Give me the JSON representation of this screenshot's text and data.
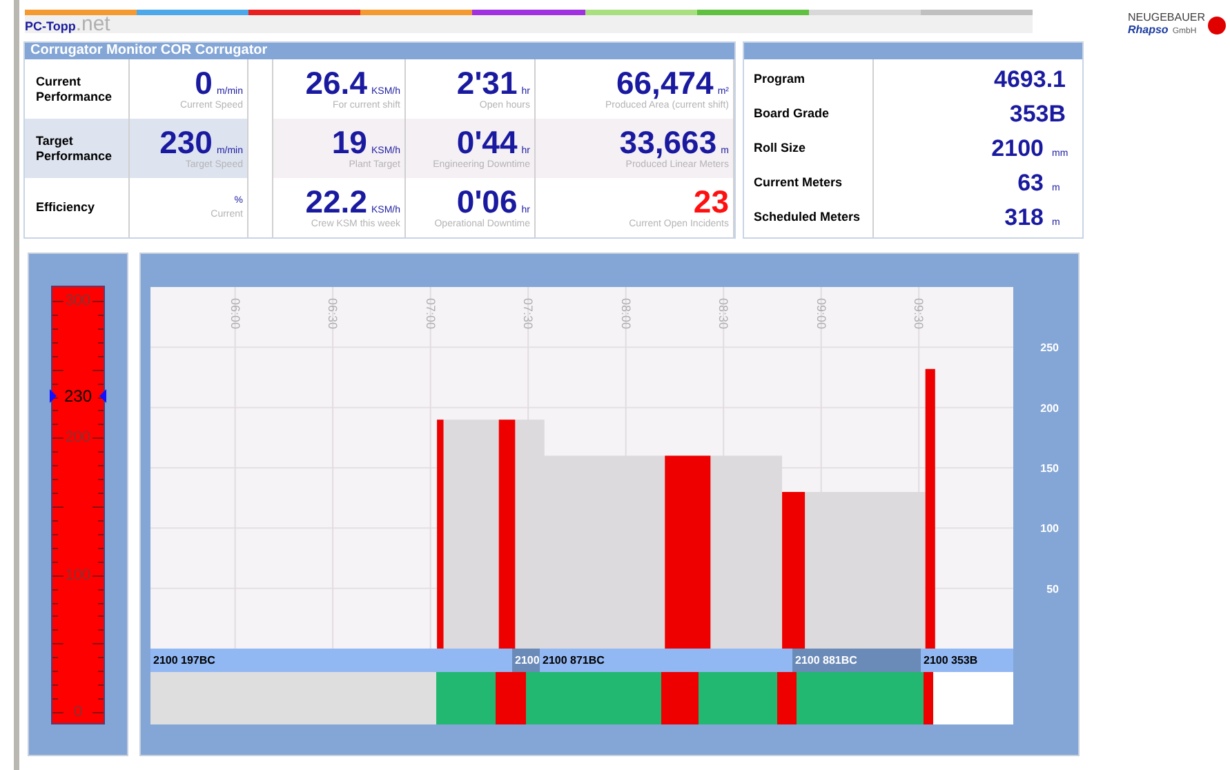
{
  "header": {
    "logo": "PC-Topp",
    "logo_suffix": ".net",
    "brand": {
      "line1": "NEUGEBAUER",
      "line2": "Rhapso",
      "line3": "GmbH"
    }
  },
  "metrics": {
    "title": "Corrugator Monitor COR Corrugator",
    "rows": [
      {
        "label": "Current Performance",
        "highlighted": false,
        "speed": {
          "value": "0",
          "unit": "m/min",
          "caption": "Current Speed"
        },
        "cells": [
          {
            "value": "26.4",
            "unit": "KSM/h",
            "caption": "For current shift",
            "alert": false
          },
          {
            "value": "2'31",
            "unit": "hr",
            "caption": "Open hours",
            "alert": false
          },
          {
            "value": "66,474",
            "unit": "m²",
            "caption": "Produced Area (current shift)",
            "alert": false
          }
        ]
      },
      {
        "label": "Target Performance",
        "highlighted": true,
        "speed": {
          "value": "230",
          "unit": "m/min",
          "caption": "Target Speed"
        },
        "cells": [
          {
            "value": "19",
            "unit": "KSM/h",
            "caption": "Plant Target",
            "alert": false
          },
          {
            "value": "0'44",
            "unit": "hr",
            "caption": "Engineering Downtime",
            "alert": false
          },
          {
            "value": "33,663",
            "unit": "m",
            "caption": "Produced Linear Meters",
            "alert": false
          }
        ]
      },
      {
        "label": "Efficiency",
        "highlighted": false,
        "speed": {
          "unit": "%",
          "caption": "Current"
        },
        "cells": [
          {
            "value": "22.2",
            "unit": "KSM/h",
            "caption": "Crew KSM this week",
            "alert": false
          },
          {
            "value": "0'06",
            "unit": "hr",
            "caption": "Operational Downtime",
            "alert": false
          },
          {
            "value": "23",
            "caption": "Current Open Incidents",
            "alert": true
          }
        ]
      }
    ]
  },
  "order_info": [
    {
      "label": "Program",
      "value": "4693.1"
    },
    {
      "label": "Board Grade",
      "value": "353B"
    },
    {
      "label": "Roll Size",
      "value": "2100",
      "unit": "mm"
    },
    {
      "label": "Current Meters",
      "value": "63",
      "unit": "m"
    },
    {
      "label": "Scheduled Meters",
      "value": "318",
      "unit": "m"
    }
  ],
  "gauge": {
    "labels": [
      "300",
      "200",
      "100",
      "0"
    ],
    "marker": {
      "text": "230",
      "level": 0.767
    }
  },
  "speed_chart": {
    "chart_data": {
      "type": "area",
      "x": [
        422,
        422,
        424,
        424,
        441,
        441,
        446,
        446,
        455,
        455,
        492,
        492,
        506,
        506,
        528,
        528,
        535,
        535,
        572,
        572,
        575,
        575
      ],
      "series": [
        {
          "color": "#dcdadc",
          "values": [
            0,
            190,
            190,
            190,
            190,
            190,
            190,
            190,
            190,
            160,
            160,
            160,
            160,
            160,
            160,
            130,
            130,
            130,
            130,
            0,
            0,
            0
          ]
        },
        {
          "color": "#ee0000",
          "values": [
            0,
            190,
            190,
            0,
            0,
            190,
            190,
            0,
            0,
            0,
            0,
            160,
            160,
            0,
            0,
            130,
            130,
            0,
            0,
            232,
            232,
            0
          ]
        }
      ],
      "xlim": [
        334,
        599
      ],
      "ylim": [
        0,
        300
      ],
      "stacked": false,
      "grid": true,
      "xticks": [
        {
          "value": 360,
          "label": "06:00"
        },
        {
          "value": 390,
          "label": "06:30"
        },
        {
          "value": 420,
          "label": "07:00"
        },
        {
          "value": 450,
          "label": "07:30"
        },
        {
          "value": 480,
          "label": "08:00"
        },
        {
          "value": 510,
          "label": "08:30"
        },
        {
          "value": 540,
          "label": "09:00"
        },
        {
          "value": 570,
          "label": "09:30"
        }
      ],
      "yticks": [
        50,
        100,
        150,
        200,
        250
      ]
    },
    "orders": [
      {
        "label": "2100 197BC",
        "selected": false
      },
      {
        "label": "2100",
        "selected": true
      },
      {
        "label": "2100 871BC",
        "selected": false
      },
      {
        "label": "2100 881BC",
        "selected": true
      },
      {
        "label": "2100 353B",
        "selected": false
      }
    ],
    "status": [
      {
        "color": "#dedede"
      },
      {
        "color": "#22b872"
      },
      {
        "color": "#ee0000"
      },
      {
        "color": "#22b872"
      },
      {
        "color": "#ee0000"
      },
      {
        "color": "#22b872"
      },
      {
        "color": "#ee0000"
      },
      {
        "color": "#22b872"
      },
      {
        "color": "#ee0000"
      },
      {
        "color": "#ffffff"
      }
    ]
  }
}
